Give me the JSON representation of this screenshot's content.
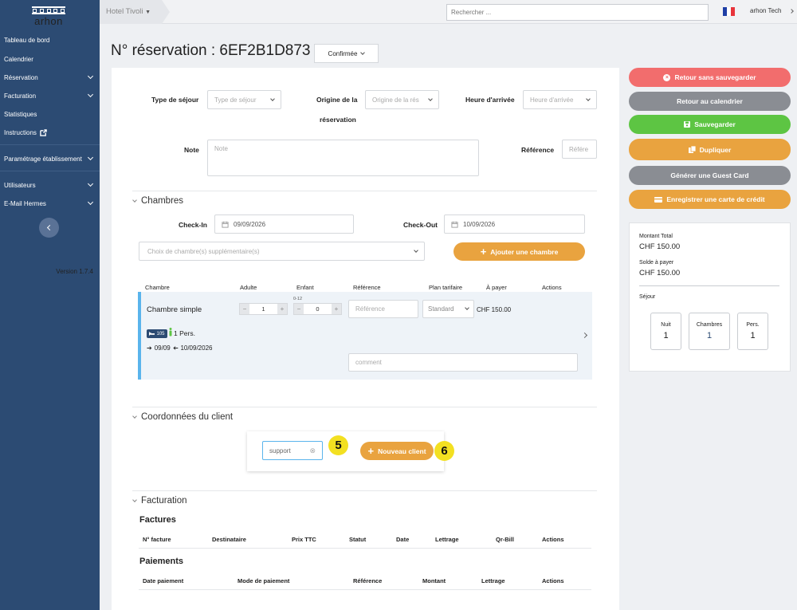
{
  "sidebar": {
    "logo": "arhon",
    "items": [
      {
        "label": "Tableau de bord"
      },
      {
        "label": "Calendrier"
      },
      {
        "label": "Réservation"
      },
      {
        "label": "Facturation"
      },
      {
        "label": "Statistiques"
      },
      {
        "label": "Instructions"
      },
      {
        "label": "Paramétrage établissement"
      },
      {
        "label": "Utilisateurs"
      },
      {
        "label": "E-Mail Hermes"
      }
    ],
    "version": "Version 1.7.4"
  },
  "topbar": {
    "hotel": "Hotel Tivoli",
    "search_placeholder": "Rechercher ...",
    "user": "arhon Tech"
  },
  "page": {
    "title": "N° réservation : 6EF2B1D873 -",
    "status": "Confirmée"
  },
  "form": {
    "type_sejour_label": "Type de séjour",
    "type_sejour_placeholder": "Type de séjour",
    "origine_label_1": "Origine de la",
    "origine_label_2": "réservation",
    "origine_placeholder": "Origine de la rés",
    "heure_label": "Heure d'arrivée",
    "heure_placeholder": "Heure d'arrivée",
    "note_label": "Note",
    "note_placeholder": "Note",
    "reference_label": "Référence",
    "reference_placeholder": "Référe"
  },
  "chambres": {
    "title": "Chambres",
    "checkin_label": "Check-In",
    "checkin_value": "09/09/2026",
    "checkout_label": "Check-Out",
    "checkout_value": "10/09/2026",
    "extra_placeholder": "Choix de chambre(s) supplémentaire(s)",
    "add_button": "Ajouter une chambre",
    "columns": [
      "Chambre",
      "Adulte",
      "Enfant",
      "Référence",
      "Plan tarifaire",
      "À payer",
      "Actions"
    ],
    "row": {
      "name": "Chambre simple",
      "adults": "1",
      "child_range": "0-12",
      "children": "0",
      "reference_placeholder": "Référence",
      "plan": "Standard",
      "price": "CHF 150.00",
      "room_number": "105",
      "persons": "1 Pers.",
      "date_from": "09/09",
      "date_to": "10/09/2026",
      "comment_placeholder": "comment"
    }
  },
  "client": {
    "title": "Coordonnées du client",
    "search_value": "support",
    "new_button": "Nouveau client",
    "callout_a": "5",
    "callout_b": "6"
  },
  "facturation": {
    "title": "Facturation",
    "factures_title": "Factures",
    "factures_columns": [
      "N° facture",
      "Destinataire",
      "Prix TTC",
      "Statut",
      "Date",
      "Lettrage",
      "Qr-Bill",
      "Actions"
    ],
    "paiements_title": "Paiements",
    "paiements_columns": [
      "Date paiement",
      "Mode de paiement",
      "Référence",
      "Montant",
      "Lettrage",
      "Actions"
    ]
  },
  "actions": {
    "back_no_save": "Retour sans sauvegarder",
    "back_calendar": "Retour au calendrier",
    "save": "Sauvegarder",
    "duplicate": "Dupliquer",
    "guest_card": "Générer une Guest Card",
    "credit_card": "Enregistrer une carte de crédit"
  },
  "summary": {
    "total_label": "Montant Total",
    "total_value": "CHF 150.00",
    "balance_label": "Solde à payer",
    "balance_value": "CHF 150.00",
    "stay_label": "Séjour",
    "nights_label": "Nuit",
    "nights_value": "1",
    "rooms_label": "Chambres",
    "rooms_value": "1",
    "persons_label": "Pers.",
    "persons_value": "1"
  },
  "colors": {
    "sidebar": "#2c4b73",
    "orange": "#e9a33f",
    "red": "#f26d6d",
    "grey": "#8a8d93",
    "green": "#5dc543",
    "room_bar": "#5ab4ec"
  }
}
